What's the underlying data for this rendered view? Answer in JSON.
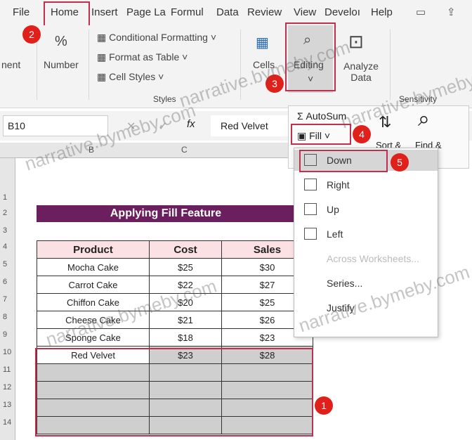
{
  "menu": [
    "File",
    "Home",
    "Insert",
    "Page La",
    "Formul",
    "Data",
    "Review",
    "View",
    "Develoı",
    "Help"
  ],
  "ribbon": {
    "alignment_partial": "nent",
    "number": "Number",
    "percent_symbol": "%",
    "conditional_formatting": "Conditional Formatting",
    "format_as_table": "Format as Table",
    "cell_styles": "Cell Styles",
    "styles_group": "Styles",
    "cells": "Cells",
    "editing": "Editing",
    "analyze_data": "Analyze Data",
    "sensitivity": "Sensitivity"
  },
  "editing_panel": {
    "autosum": "AutoSum",
    "fill": "Fill",
    "sort_filter": "Sort &",
    "find_select": "Find &"
  },
  "fill_menu": [
    "Down",
    "Right",
    "Up",
    "Left",
    "Across Worksheets...",
    "Series...",
    "Justify"
  ],
  "formula_bar": {
    "name_box": "B10",
    "fx": "fx",
    "value": "Red Velvet"
  },
  "columns": [
    "B",
    "C"
  ],
  "rows": [
    "1",
    "2",
    "3",
    "4",
    "5",
    "6",
    "7",
    "8",
    "9",
    "10",
    "11",
    "12",
    "13",
    "14"
  ],
  "sheet": {
    "title": "Applying Fill Feature",
    "headers": [
      "Product",
      "Cost",
      "Sales"
    ],
    "data": [
      [
        "Mocha Cake",
        "$25",
        "$30"
      ],
      [
        "Carrot Cake",
        "$22",
        "$27"
      ],
      [
        "Chiffon Cake",
        "$20",
        "$25"
      ],
      [
        "Cheese Cake",
        "$21",
        "$26"
      ],
      [
        "Sponge Cake",
        "$18",
        "$23"
      ],
      [
        "Red Velvet",
        "$23",
        "$28"
      ]
    ]
  },
  "steps": [
    "1",
    "2",
    "3",
    "4",
    "5"
  ],
  "accent": {
    "step_badge": "#e0201b",
    "highlight_box": "#c0304e",
    "title_fill": "#6b1f5e"
  },
  "watermark": "narrative.bymeby.com"
}
